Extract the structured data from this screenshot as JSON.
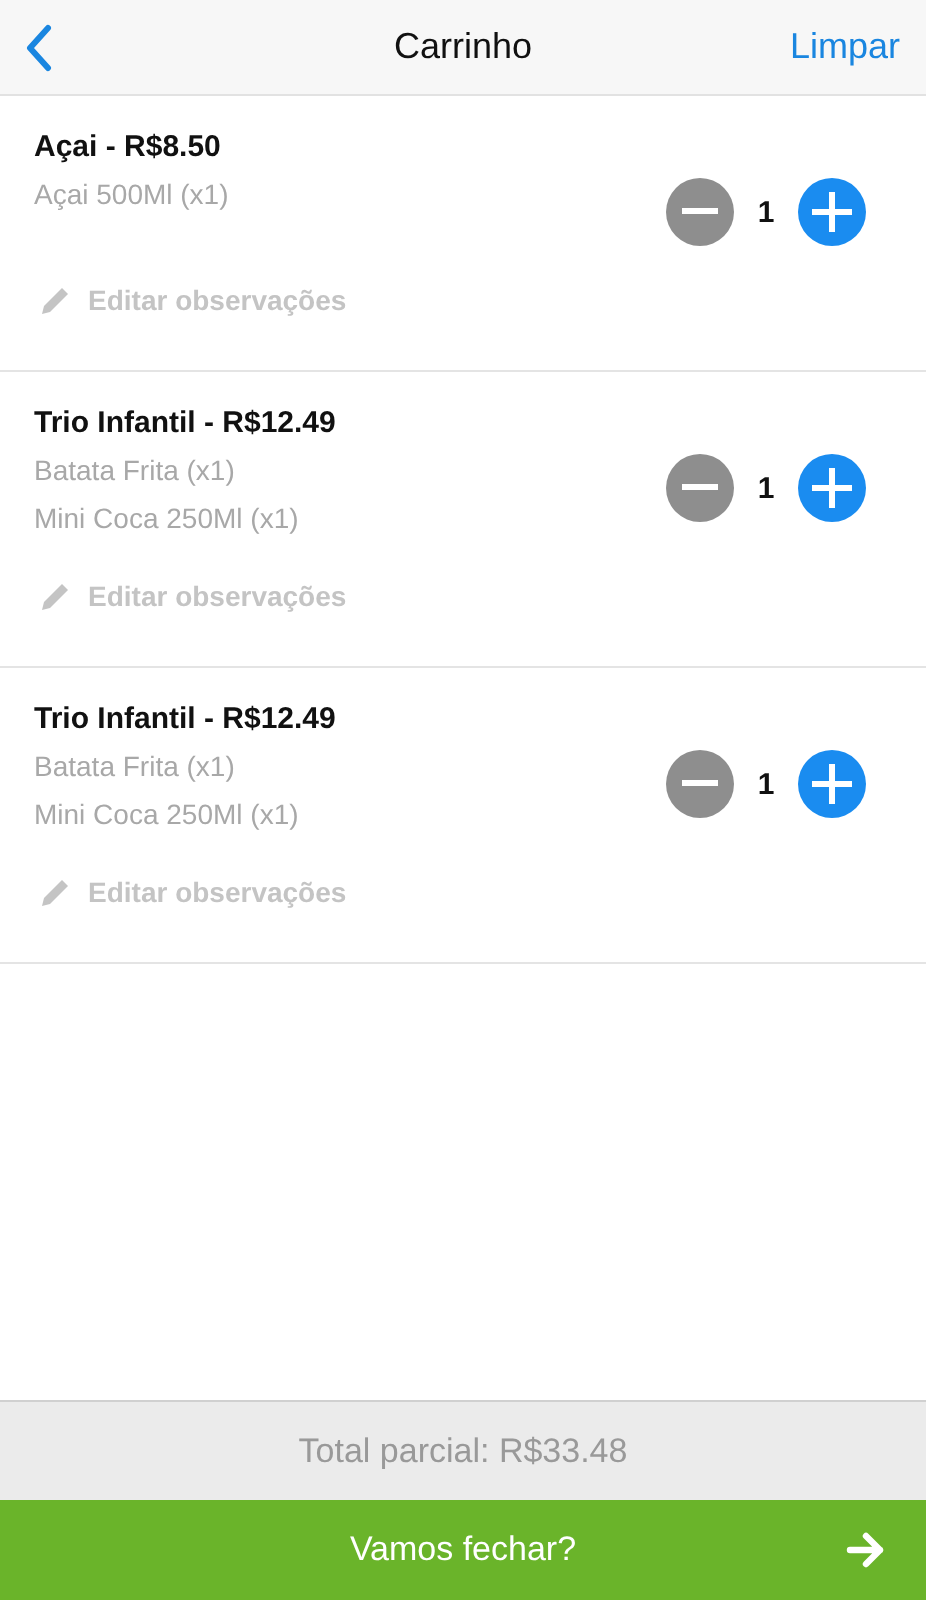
{
  "header": {
    "title": "Carrinho",
    "action": "Limpar"
  },
  "items": [
    {
      "title": "Açai - R$8.50",
      "details": [
        "Açai 500Ml (x1)"
      ],
      "edit_label": "Editar observações",
      "quantity": "1"
    },
    {
      "title": "Trio Infantil - R$12.49",
      "details": [
        "Batata Frita (x1)",
        "Mini Coca 250Ml (x1)"
      ],
      "edit_label": "Editar observações",
      "quantity": "1"
    },
    {
      "title": "Trio Infantil - R$12.49",
      "details": [
        "Batata Frita (x1)",
        "Mini Coca 250Ml (x1)"
      ],
      "edit_label": "Editar observações",
      "quantity": "1"
    }
  ],
  "subtotal": "Total parcial: R$33.48",
  "checkout_button": "Vamos fechar?"
}
